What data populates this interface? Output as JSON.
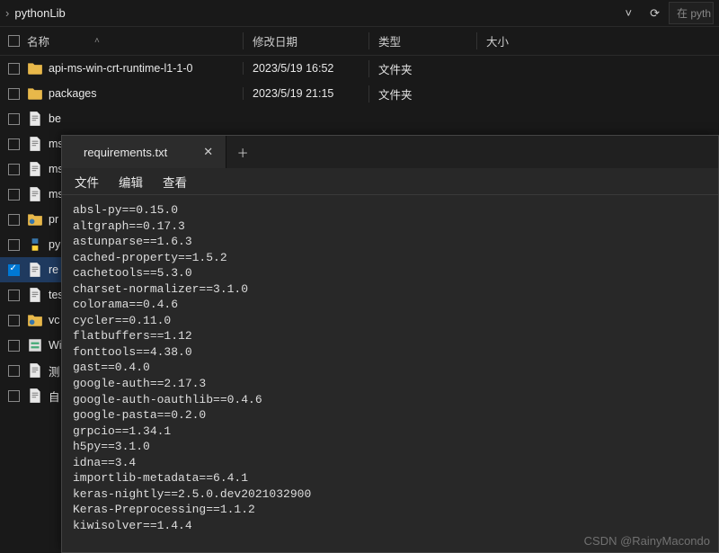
{
  "path": {
    "current": "pythonLib"
  },
  "search": {
    "placeholder": "在 pyth"
  },
  "columns": {
    "name": "名称",
    "date": "修改日期",
    "type": "类型",
    "size": "大小"
  },
  "files": [
    {
      "name": "api-ms-win-crt-runtime-l1-1-0",
      "date": "2023/5/19 16:52",
      "type": "文件夹",
      "icon": "folder",
      "checked": false
    },
    {
      "name": "packages",
      "date": "2023/5/19 21:15",
      "type": "文件夹",
      "icon": "folder",
      "checked": false
    },
    {
      "name": "be",
      "icon": "file-txt",
      "checked": false
    },
    {
      "name": "ms",
      "icon": "file-txt",
      "checked": false
    },
    {
      "name": "ms",
      "icon": "file-txt",
      "checked": false
    },
    {
      "name": "ms",
      "icon": "file-txt",
      "checked": false
    },
    {
      "name": "pr",
      "icon": "folder-py",
      "checked": false
    },
    {
      "name": "py",
      "icon": "python",
      "checked": false
    },
    {
      "name": "re",
      "icon": "file-txt",
      "checked": true
    },
    {
      "name": "tes",
      "icon": "file-txt",
      "checked": false
    },
    {
      "name": "vc",
      "icon": "folder-py",
      "checked": false
    },
    {
      "name": "Wi",
      "icon": "bat",
      "checked": false
    },
    {
      "name": "测",
      "icon": "file-txt",
      "checked": false
    },
    {
      "name": "自",
      "icon": "file-txt",
      "checked": false
    }
  ],
  "notepad": {
    "tab_title": "requirements.txt",
    "menu": {
      "file": "文件",
      "edit": "编辑",
      "view": "查看"
    },
    "content": "absl-py==0.15.0\naltgraph==0.17.3\nastunparse==1.6.3\ncached-property==1.5.2\ncachetools==5.3.0\ncharset-normalizer==3.1.0\ncolorama==0.4.6\ncycler==0.11.0\nflatbuffers==1.12\nfonttools==4.38.0\ngast==0.4.0\ngoogle-auth==2.17.3\ngoogle-auth-oauthlib==0.4.6\ngoogle-pasta==0.2.0\ngrpcio==1.34.1\nh5py==3.1.0\nidna==3.4\nimportlib-metadata==6.4.1\nkeras-nightly==2.5.0.dev2021032900\nKeras-Preprocessing==1.1.2\nkiwisolver==1.4.4"
  },
  "watermark": "CSDN @RainyMacondo"
}
